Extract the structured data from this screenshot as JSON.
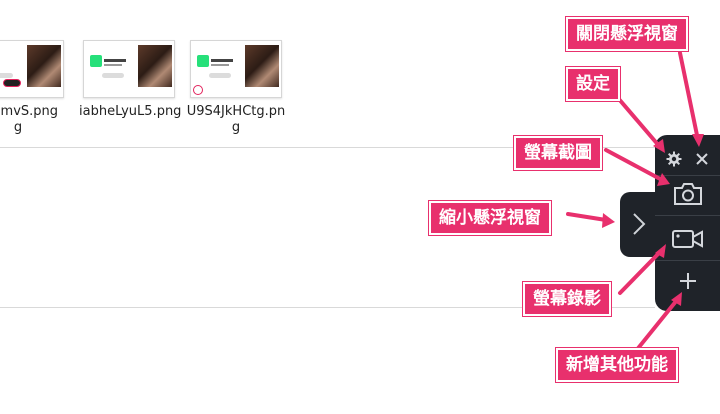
{
  "files": [
    {
      "name_line1": "AwimvS.png",
      "name_line2": "g"
    },
    {
      "name_line1": "iabheLyuL5.png",
      "name_line2": ""
    },
    {
      "name_line1": "U9S4JkHCtg.pn",
      "name_line2": "g"
    }
  ],
  "labels": {
    "close_float": "關閉懸浮視窗",
    "settings": "設定",
    "screenshot": "螢幕截圖",
    "collapse_float": "縮小懸浮視窗",
    "record": "螢幕錄影",
    "add_features": "新增其他功能"
  },
  "colors": {
    "panel": "#1f2329",
    "label_bg": "#e8306d",
    "arrow": "#e8306d"
  }
}
